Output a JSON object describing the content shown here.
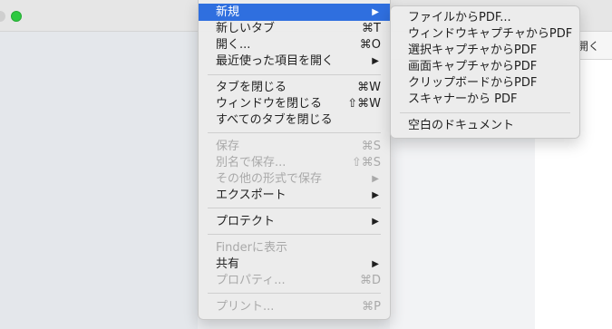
{
  "background": {
    "doc_strip_label": "開く"
  },
  "menu": {
    "items": [
      {
        "label": "新規",
        "shortcut": "",
        "arrow": "▶"
      },
      {
        "label": "新しいタブ",
        "shortcut": "⌘T",
        "arrow": ""
      },
      {
        "label": "開く...",
        "shortcut": "⌘O",
        "arrow": ""
      },
      {
        "label": "最近使った項目を開く",
        "shortcut": "",
        "arrow": "▶"
      },
      {
        "label": "タブを閉じる",
        "shortcut": "⌘W",
        "arrow": ""
      },
      {
        "label": "ウィンドウを閉じる",
        "shortcut": "⇧⌘W",
        "arrow": ""
      },
      {
        "label": "すべてのタブを閉じる",
        "shortcut": "",
        "arrow": ""
      },
      {
        "label": "保存",
        "shortcut": "⌘S",
        "arrow": ""
      },
      {
        "label": "別名で保存...",
        "shortcut": "⇧⌘S",
        "arrow": ""
      },
      {
        "label": "その他の形式で保存",
        "shortcut": "",
        "arrow": "▶"
      },
      {
        "label": "エクスポート",
        "shortcut": "",
        "arrow": "▶"
      },
      {
        "label": "プロテクト",
        "shortcut": "",
        "arrow": "▶"
      },
      {
        "label": "Finderに表示",
        "shortcut": "",
        "arrow": ""
      },
      {
        "label": "共有",
        "shortcut": "",
        "arrow": "▶"
      },
      {
        "label": "プロパティ...",
        "shortcut": "⌘D",
        "arrow": ""
      },
      {
        "label": "プリント...",
        "shortcut": "⌘P",
        "arrow": ""
      }
    ]
  },
  "submenu": {
    "items": [
      {
        "label": "ファイルからPDF..."
      },
      {
        "label": "ウィンドウキャプチャからPDF"
      },
      {
        "label": "選択キャプチャからPDF"
      },
      {
        "label": "画面キャプチャからPDF"
      },
      {
        "label": "クリップボードからPDF"
      },
      {
        "label": "スキャナーから PDF"
      },
      {
        "label": "空白のドキュメント"
      }
    ]
  },
  "colors": {
    "highlight": "#2f6fdf",
    "disabled": "#a9a9a9",
    "green_button": "#2ec941"
  }
}
